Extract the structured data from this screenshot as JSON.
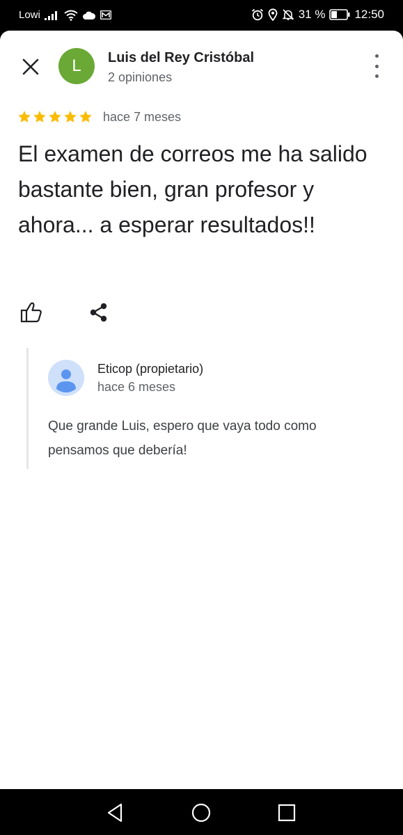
{
  "status_bar": {
    "carrier": "Lowi",
    "battery_percent": "31 %",
    "time": "12:50"
  },
  "review": {
    "author_initial": "L",
    "author_name": "Luis del Rey Cristóbal",
    "author_reviews": "2 opiniones",
    "rating": 5,
    "time": "hace 7 meses",
    "text": "El examen de correos me ha salido bastante bien, gran profesor y ahora... a esperar resultados!!"
  },
  "owner_reply": {
    "name": "Eticop (propietario)",
    "time": "hace 6 meses",
    "text": "Que grande Luis, espero que vaya todo como pensamos que debería!"
  },
  "colors": {
    "avatar": "#6aa935",
    "star": "#fbbc04",
    "text": "#202124",
    "secondary": "#5f6368"
  },
  "icons": [
    "close-icon",
    "more-vert-icon",
    "star-icon",
    "thumb-up-icon",
    "share-icon",
    "person-icon",
    "back-icon",
    "home-icon",
    "recents-icon"
  ]
}
